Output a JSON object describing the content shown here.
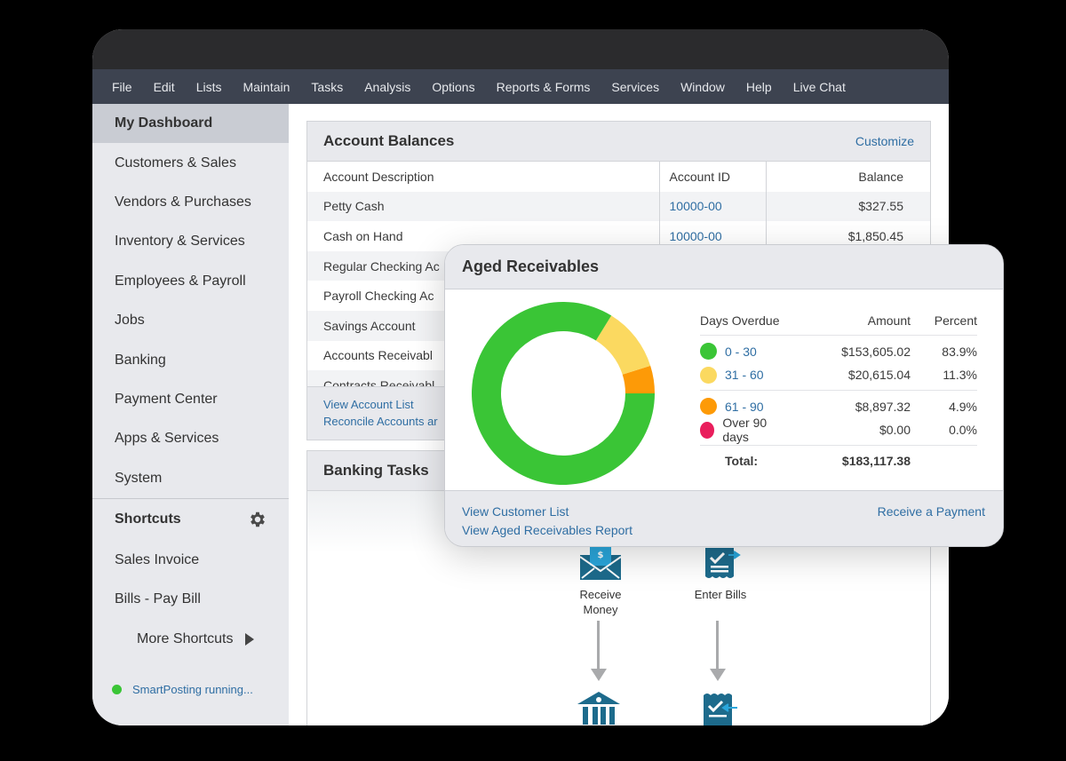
{
  "menu": [
    "File",
    "Edit",
    "Lists",
    "Maintain",
    "Tasks",
    "Analysis",
    "Options",
    "Reports & Forms",
    "Services",
    "Window",
    "Help",
    "Live Chat"
  ],
  "sidebar": {
    "items": [
      {
        "label": "My Dashboard",
        "active": true
      },
      {
        "label": "Customers & Sales"
      },
      {
        "label": "Vendors & Purchases"
      },
      {
        "label": "Inventory & Services"
      },
      {
        "label": "Employees & Payroll"
      },
      {
        "label": "Jobs"
      },
      {
        "label": "Banking"
      },
      {
        "label": "Payment Center"
      },
      {
        "label": "Apps & Services"
      },
      {
        "label": "System"
      }
    ],
    "shortcuts_title": "Shortcuts",
    "shortcuts": [
      "Sales Invoice",
      "Bills - Pay Bill"
    ],
    "more_shortcuts": "More Shortcuts",
    "status": "SmartPosting running..."
  },
  "account_balances": {
    "title": "Account Balances",
    "customize": "Customize",
    "columns": [
      "Account Description",
      "Account ID",
      "Balance"
    ],
    "rows": [
      {
        "desc": "Petty Cash",
        "id": "10000-00",
        "balance": "$327.55"
      },
      {
        "desc": "Cash on Hand",
        "id": "10000-00",
        "balance": "$1,850.45"
      },
      {
        "desc": "Regular Checking Ac",
        "id": "",
        "balance": ""
      },
      {
        "desc": "Payroll Checking Ac",
        "id": "",
        "balance": ""
      },
      {
        "desc": "Savings Account",
        "id": "",
        "balance": ""
      },
      {
        "desc": "Accounts Receivabl",
        "id": "",
        "balance": ""
      },
      {
        "desc": "Contracts Receivabl",
        "id": "",
        "balance": ""
      }
    ],
    "links": [
      "View Account List",
      "Reconcile Accounts ar"
    ]
  },
  "banking_tasks": {
    "title": "Banking Tasks",
    "tasks": [
      {
        "label": "Receive Money",
        "icon": "envelope-dollar-icon"
      },
      {
        "label": "Enter Bills",
        "icon": "bill-check-icon"
      }
    ]
  },
  "aged_receivables": {
    "title": "Aged Receivables",
    "columns": [
      "Days Overdue",
      "Amount",
      "Percent"
    ],
    "rows": [
      {
        "label": "0 - 30",
        "amount": "$153,605.02",
        "percent": "83.9%",
        "color": "#3ac536",
        "link": true
      },
      {
        "label": "31 - 60",
        "amount": "$20,615.04",
        "percent": "11.3%",
        "color": "#fbd960",
        "link": true
      },
      {
        "label": "61 - 90",
        "amount": "$8,897.32",
        "percent": "4.9%",
        "color": "#fd9a07",
        "link": true
      },
      {
        "label": "Over 90 days",
        "amount": "$0.00",
        "percent": "0.0%",
        "color": "#e91e5c",
        "link": false
      }
    ],
    "total_label": "Total:",
    "total_amount": "$183,117.38",
    "links_left": [
      "View Customer List",
      "View Aged Receivables Report"
    ],
    "link_right": "Receive a Payment"
  },
  "chart_data": {
    "type": "pie",
    "title": "Aged Receivables",
    "categories": [
      "0 - 30",
      "31 - 60",
      "61 - 90",
      "Over 90 days"
    ],
    "values": [
      83.9,
      11.3,
      4.9,
      0.0
    ],
    "colors": [
      "#3ac536",
      "#fbd960",
      "#fd9a07",
      "#e91e5c"
    ],
    "donut": true
  }
}
